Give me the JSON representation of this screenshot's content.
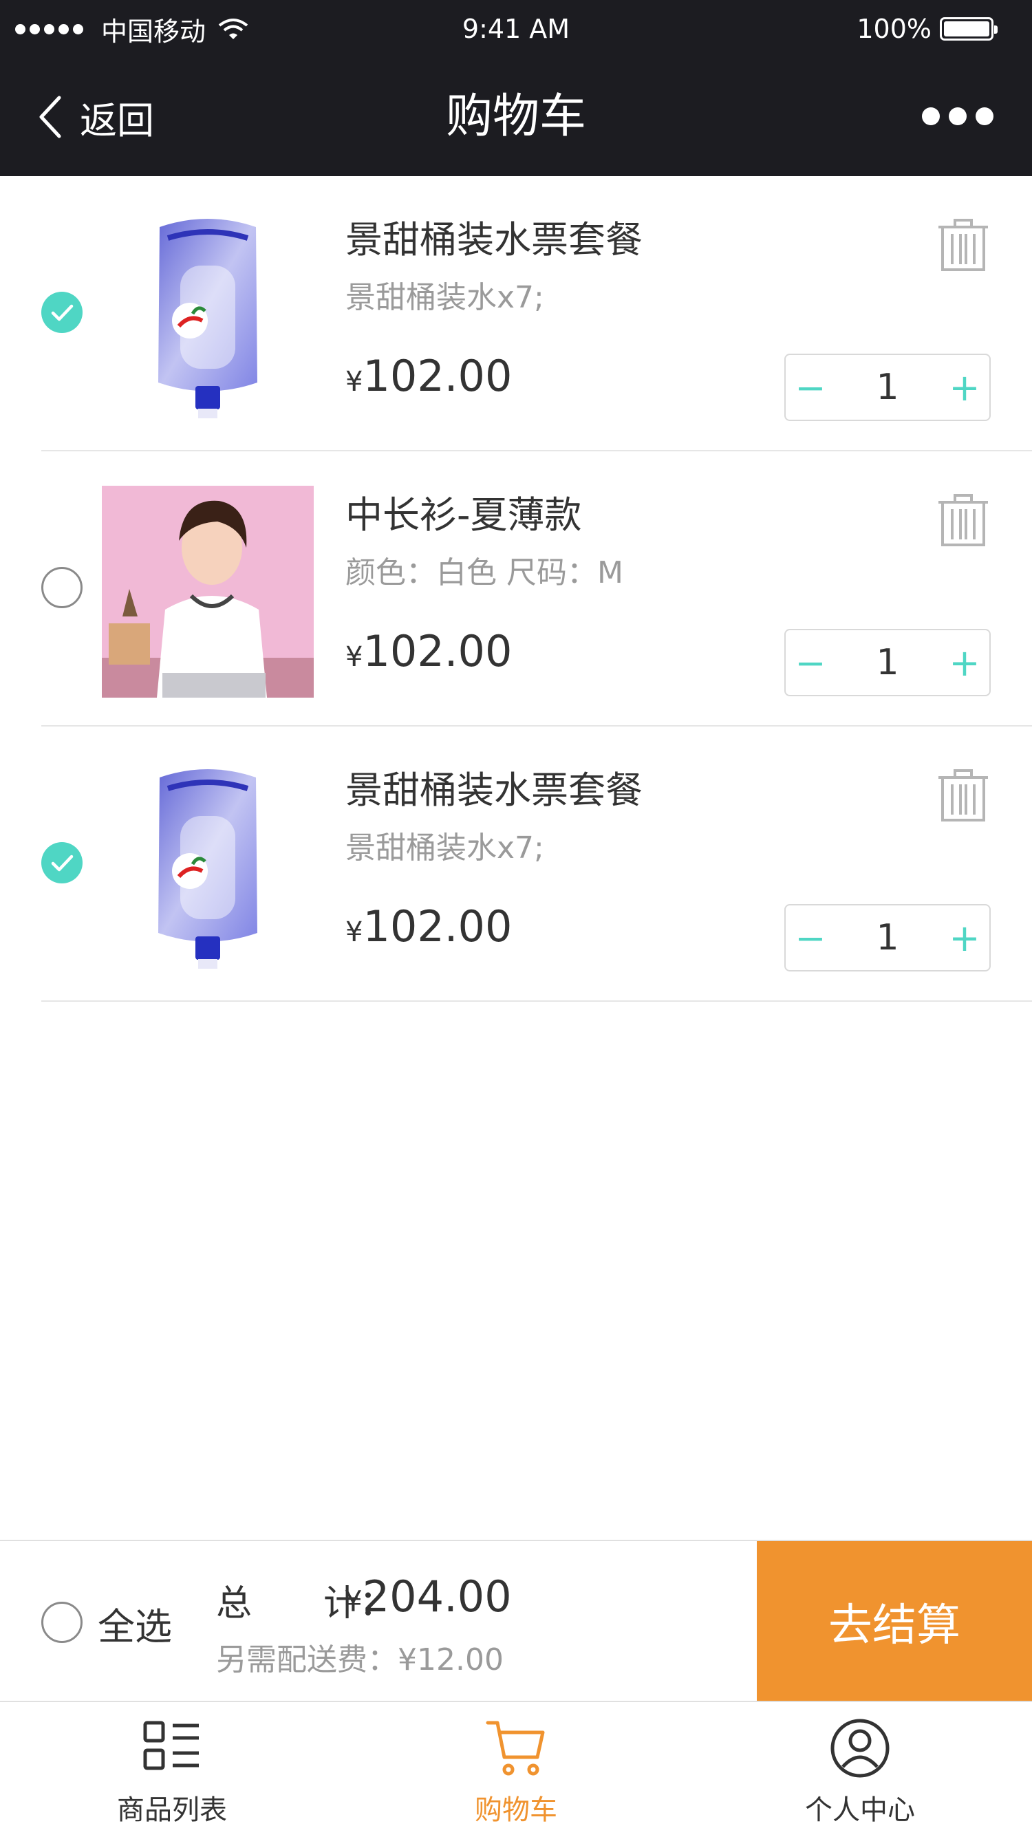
{
  "status_bar": {
    "carrier": "中国移动",
    "time": "9:41 AM",
    "battery": "100%"
  },
  "nav": {
    "back_label": "返回",
    "title": "购物车"
  },
  "cart": {
    "items": [
      {
        "name": "景甜桶装水票套餐",
        "spec": "景甜桶装水x7;",
        "currency": "¥",
        "price": "102.00",
        "quantity": "1",
        "selected": true,
        "image": "water-bottle"
      },
      {
        "name": "中长衫-夏薄款",
        "spec": "颜色：白色 尺码：M",
        "currency": "¥",
        "price": "102.00",
        "quantity": "1",
        "selected": false,
        "image": "clothing-photo"
      },
      {
        "name": "景甜桶装水票套餐",
        "spec": "景甜桶装水x7;",
        "currency": "¥",
        "price": "102.00",
        "quantity": "1",
        "selected": true,
        "image": "water-bottle"
      }
    ],
    "stepper": {
      "minus": "−",
      "plus": "+"
    }
  },
  "footer": {
    "select_all": "全选",
    "total_label": "总　　计：",
    "total_currency": "¥",
    "total_value": "204.00",
    "delivery": "另需配送费：¥12.00",
    "checkout": "去结算"
  },
  "tabbar": {
    "tabs": [
      {
        "label": "商品列表",
        "icon": "list-icon",
        "active": false
      },
      {
        "label": "购物车",
        "icon": "cart-icon",
        "active": true
      },
      {
        "label": "个人中心",
        "icon": "user-icon",
        "active": false
      }
    ]
  },
  "colors": {
    "accent_teal": "#4fd6c4",
    "accent_orange": "#f0932f",
    "nav_bg": "#1c1c21"
  }
}
